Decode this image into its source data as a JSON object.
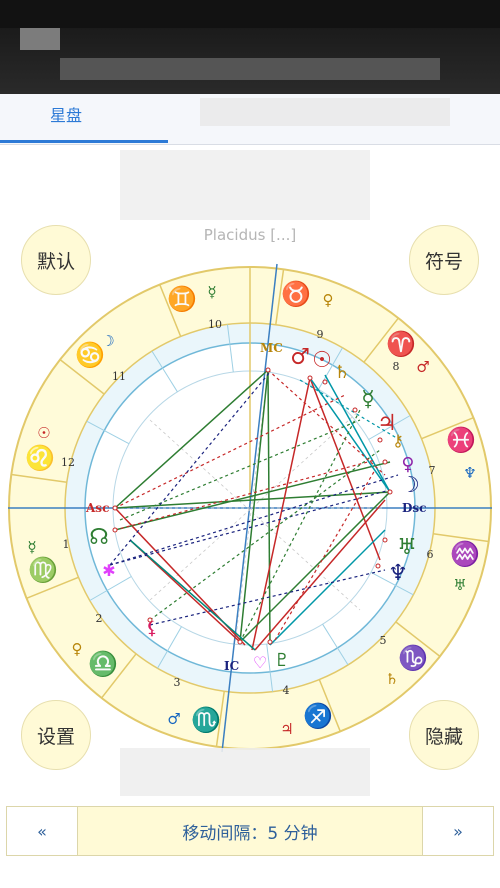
{
  "statusbar": {
    "left_text": ""
  },
  "tabs": {
    "active_label": "星盘"
  },
  "house_system_text": "Placidus [...]",
  "buttons": {
    "default_label": "默认",
    "symbol_label": "符号",
    "settings_label": "设置",
    "hide_label": "隐藏"
  },
  "nav": {
    "prev_label": "«",
    "next_label": "»",
    "interval_text": "移动间隔：5 分钟"
  },
  "chart": {
    "houses": [
      "1",
      "2",
      "3",
      "4",
      "5",
      "6",
      "7",
      "8",
      "9",
      "10",
      "11",
      "12"
    ],
    "angles": [
      "Asc",
      "Dsc",
      "MC",
      "IC"
    ],
    "signs": [
      "♈",
      "♉",
      "♊",
      "♋",
      "♌",
      "♍",
      "♎",
      "♏",
      "♐",
      "♑",
      "♒",
      "♓"
    ],
    "rulers": [
      "♂",
      "♀",
      "☿",
      "☽",
      "☉",
      "☿",
      "♀",
      "♂",
      "♃",
      "♄",
      "♅",
      "♆"
    ],
    "planets": [
      "♂",
      "☉",
      "♄",
      "☿",
      "♃",
      "⚷",
      "♀",
      "☽",
      "♅",
      "♆",
      "♇",
      "☊",
      "⚸"
    ]
  }
}
